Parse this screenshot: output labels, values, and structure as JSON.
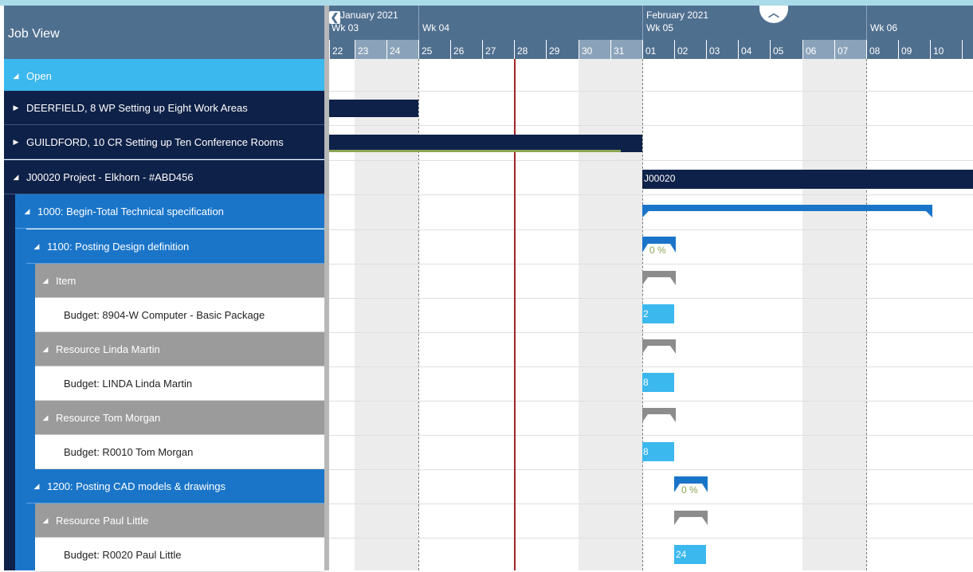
{
  "view_title": "Job View",
  "timeline": {
    "months": [
      "January 2021",
      "February 2021"
    ],
    "weeks": [
      "Wk 03",
      "Wk 04",
      "Wk 05",
      "Wk 06"
    ],
    "days": [
      "22",
      "23",
      "24",
      "25",
      "26",
      "27",
      "28",
      "29",
      "30",
      "31",
      "01",
      "02",
      "03",
      "04",
      "05",
      "06",
      "07",
      "08",
      "09",
      "10"
    ]
  },
  "rows": [
    {
      "label": "Open",
      "icon": "expanded-triangle-icon"
    },
    {
      "label": "DEERFIELD, 8 WP Setting up Eight Work Areas",
      "icon": "collapsed-triangle-icon"
    },
    {
      "label": "GUILDFORD, 10 CR Setting up Ten Conference Rooms",
      "icon": "collapsed-triangle-icon"
    },
    {
      "label": "J00020 Project - Elkhorn - #ABD456",
      "icon": "expanded-triangle-icon"
    },
    {
      "label": "1000: Begin-Total Technical specification",
      "icon": "expanded-triangle-icon"
    },
    {
      "label": "1100: Posting Design definition",
      "icon": "expanded-triangle-icon"
    },
    {
      "label": "Item",
      "icon": "expanded-triangle-icon"
    },
    {
      "label": "Budget: 8904-W Computer - Basic Package",
      "icon": ""
    },
    {
      "label": "Resource Linda Martin",
      "icon": "expanded-triangle-icon"
    },
    {
      "label": "Budget: LINDA Linda Martin",
      "icon": ""
    },
    {
      "label": "Resource Tom Morgan",
      "icon": "expanded-triangle-icon"
    },
    {
      "label": "Budget: R0010 Tom Morgan",
      "icon": ""
    },
    {
      "label": "1200: Posting CAD models & drawings",
      "icon": "expanded-triangle-icon"
    },
    {
      "label": "Resource Paul Little",
      "icon": "expanded-triangle-icon"
    },
    {
      "label": "Budget: R0020 Paul Little",
      "icon": ""
    }
  ],
  "bars": {
    "j00020": "J00020",
    "pct_1100": "0 %",
    "qty_8904": "2",
    "qty_linda": "8",
    "qty_tom": "8",
    "pct_1200": "0 %",
    "qty_paul": "24"
  },
  "glyphs": {
    "expanded": "◢",
    "collapsed": "▶",
    "up": "︿",
    "back": "❮"
  },
  "colors": {
    "header": "#4f6f8f",
    "open": "#3bb8ee",
    "dark": "#0e2148",
    "blue": "#1a75c9",
    "grey": "#9b9b9b",
    "today": "#a42323"
  }
}
